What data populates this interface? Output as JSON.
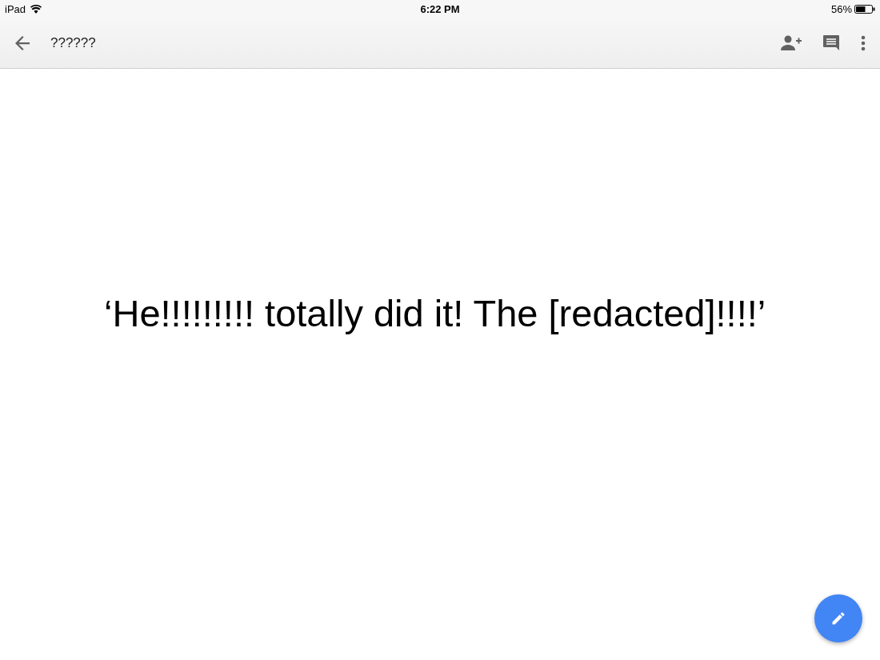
{
  "status_bar": {
    "device": "iPad",
    "time": "6:22 PM",
    "battery": "56%"
  },
  "toolbar": {
    "title": "??????"
  },
  "slide": {
    "text": "‘He!!!!!!!!! totally did it! The [redacted]!!!!’"
  }
}
